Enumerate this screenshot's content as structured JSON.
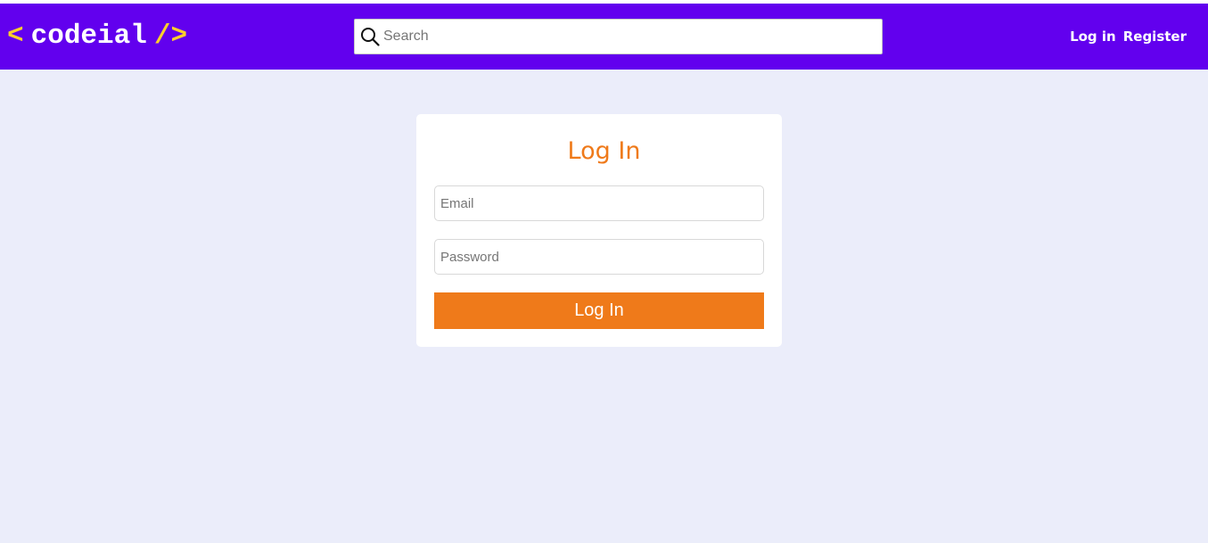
{
  "header": {
    "logo": {
      "bracket_open": "<",
      "name": "codeial",
      "bracket_close": "/>"
    },
    "search": {
      "placeholder": "Search",
      "value": "",
      "icon": "search-icon"
    },
    "links": [
      {
        "label": "Log in"
      },
      {
        "label": "Register"
      }
    ]
  },
  "login_form": {
    "title": "Log In",
    "email": {
      "placeholder": "Email",
      "value": ""
    },
    "password": {
      "placeholder": "Password",
      "value": ""
    },
    "submit_label": "Log In"
  },
  "colors": {
    "navbar": "#6200ee",
    "logo_bracket": "#fcd02c",
    "accent": "#ef7a1a",
    "page_background": "#ebedfa"
  }
}
